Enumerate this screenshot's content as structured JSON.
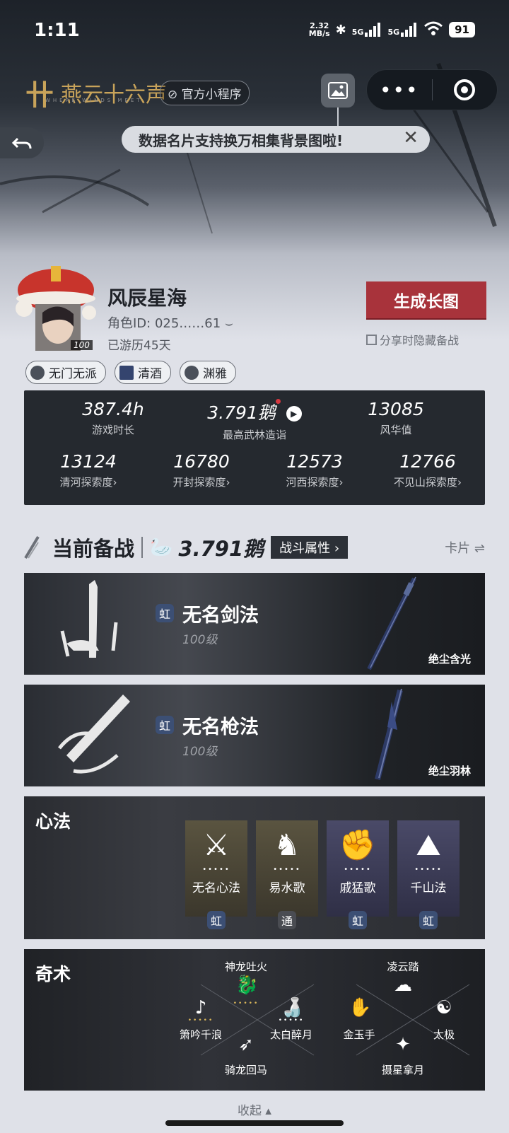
{
  "status": {
    "time": "1:11",
    "net_speed": "2.32",
    "net_unit": "MB/s",
    "sig1": "5G",
    "sig2": "5G",
    "battery": "91"
  },
  "header": {
    "logo_mark": "卄",
    "logo_text": "燕云十六声",
    "logo_sub": "WHERE WINDS MEET",
    "mini_tag": "官方小程序",
    "capsule_more": "•••",
    "tip": "数据名片支持换万相集背景图啦!",
    "tip_close": "✕"
  },
  "profile": {
    "name": "风辰星海",
    "role_id": "角色ID: 025……61",
    "played": "已游历45天",
    "level": "100",
    "generate_btn": "生成长图",
    "hide_label": "分享时隐藏备战",
    "tags": [
      "无门无派",
      "清酒",
      "渊雅"
    ]
  },
  "stats": {
    "row1": [
      {
        "value": "387.4h",
        "label": "游戏时长"
      },
      {
        "value": "3.791鹅",
        "label": "最高武林造诣"
      },
      {
        "value": "13085",
        "label": "风华值"
      }
    ],
    "row2": [
      {
        "value": "13124",
        "label": "清河探索度›"
      },
      {
        "value": "16780",
        "label": "开封探索度›"
      },
      {
        "value": "12573",
        "label": "河西探索度›"
      },
      {
        "value": "12766",
        "label": "不见山探索度›"
      }
    ]
  },
  "section": {
    "title": "当前备战",
    "power": "3.791鹅",
    "attr_btn": "战斗属性 ›",
    "card_toggle": "卡片 ⇌"
  },
  "weapons": [
    {
      "rarity": "虹",
      "name": "无名剑法",
      "level": "100级",
      "item": "绝尘含光"
    },
    {
      "rarity": "虹",
      "name": "无名枪法",
      "level": "100级",
      "item": "绝尘羽林"
    }
  ],
  "xinfa": {
    "label": "心法",
    "cards": [
      {
        "name": "无名心法",
        "badge": "虹",
        "glyph": "⚔"
      },
      {
        "name": "易水歌",
        "badge": "通",
        "glyph": "♞"
      },
      {
        "name": "戚猛歌",
        "badge": "虹",
        "glyph": "✊"
      },
      {
        "name": "千山法",
        "badge": "虹",
        "glyph": "⛰"
      }
    ]
  },
  "qishu": {
    "label": "奇术",
    "left": {
      "top": "神龙吐火",
      "left": "箫吟千浪",
      "right": "太白醉月",
      "bottom": "骑龙回马"
    },
    "right": {
      "top": "凌云踏",
      "left": "金玉手",
      "right": "太极",
      "bottom": "摄星拿月"
    }
  },
  "footer": {
    "collapse": "收起 ▴"
  }
}
